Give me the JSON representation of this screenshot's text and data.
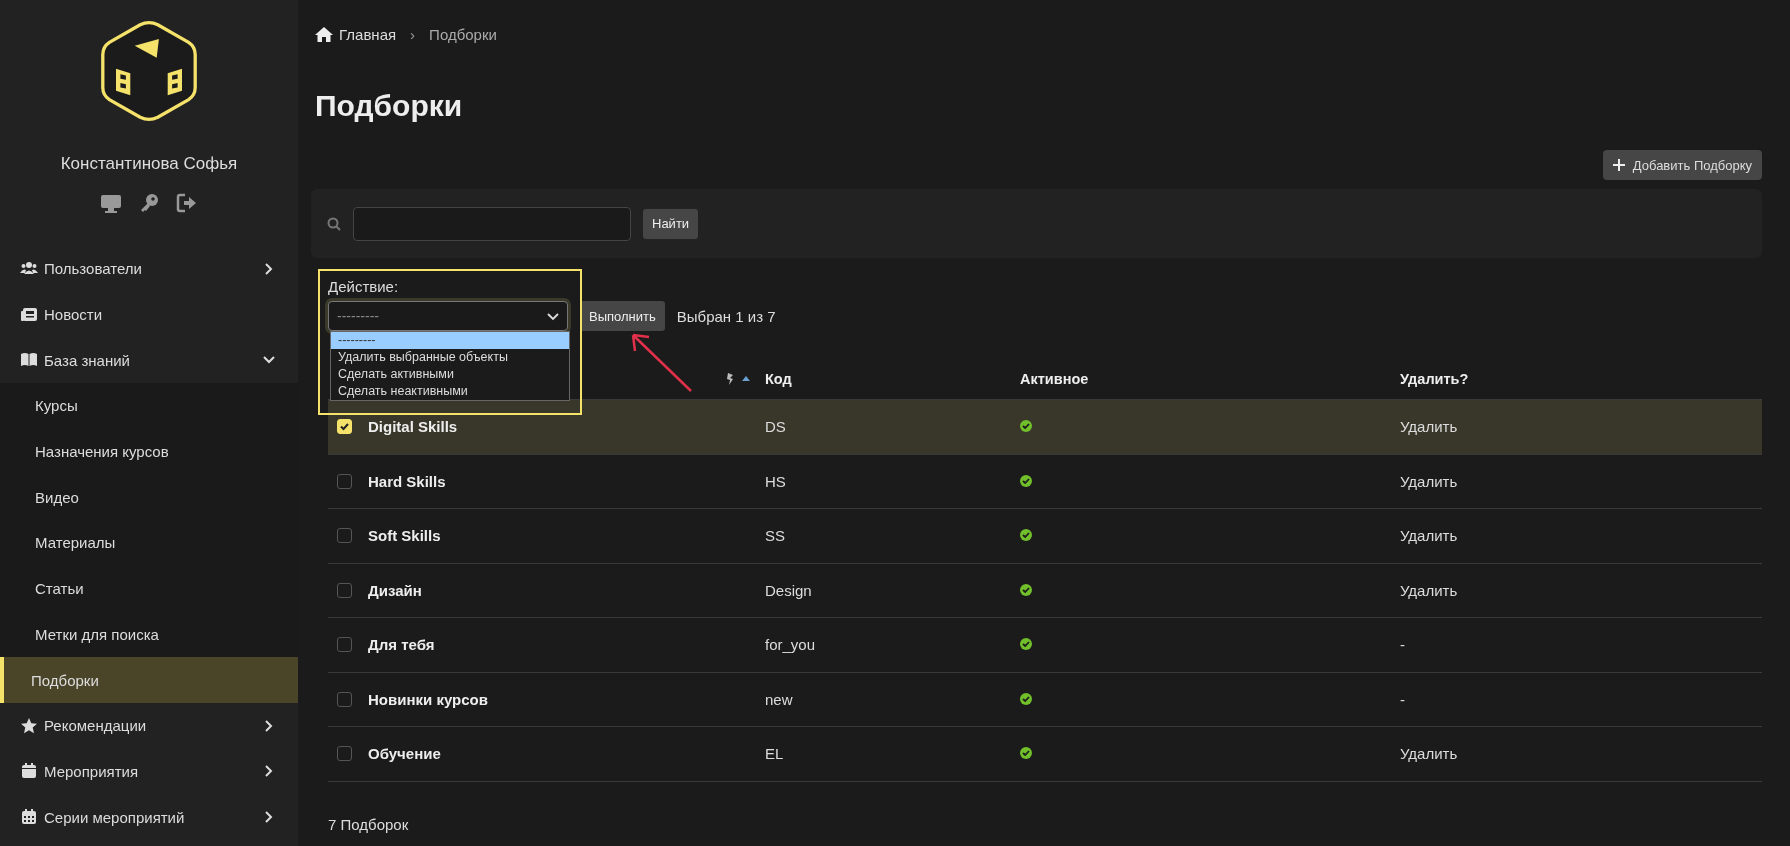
{
  "sidebar": {
    "user_name": "Константинова Софья",
    "menu": [
      {
        "label": "Пользователи",
        "kind": "group",
        "expanded": false,
        "selected": false
      },
      {
        "label": "Новости",
        "kind": "link",
        "selected": false
      },
      {
        "label": "База знаний",
        "kind": "group",
        "expanded": true,
        "selected": false,
        "children": [
          {
            "label": "Курсы",
            "selected": false
          },
          {
            "label": "Назначения курсов",
            "selected": false
          },
          {
            "label": "Видео",
            "selected": false
          },
          {
            "label": "Материалы",
            "selected": false
          },
          {
            "label": "Статьи",
            "selected": false
          },
          {
            "label": "Метки для поиска",
            "selected": false
          },
          {
            "label": "Подборки",
            "selected": true
          }
        ]
      },
      {
        "label": "Рекомендации",
        "kind": "group",
        "expanded": false,
        "selected": false
      },
      {
        "label": "Мероприятия",
        "kind": "group",
        "expanded": false,
        "selected": false
      },
      {
        "label": "Серии мероприятий",
        "kind": "group",
        "expanded": false,
        "selected": false
      }
    ]
  },
  "breadcrumb": [
    "Главная",
    "›",
    "Подборки"
  ],
  "title": "Подборки",
  "add_button": "Добавить Подборку",
  "search": {
    "button": "Найти"
  },
  "action": {
    "label": "Действие:",
    "value": "---------",
    "button": "Выполнить",
    "counter": "Выбран 1 из 7",
    "options": [
      {
        "label": "---------",
        "selected": true
      },
      {
        "label": "Удалить выбранные объекты",
        "selected": false
      },
      {
        "label": "Сделать активными",
        "selected": false
      },
      {
        "label": "Сделать неактивными",
        "selected": false
      }
    ]
  },
  "table": {
    "columns": [
      "Код",
      "Активное",
      "Удалить?"
    ],
    "rows": [
      {
        "name": "Digital Skills",
        "code": "DS",
        "active": true,
        "delete": "Удалить",
        "checked": true
      },
      {
        "name": "Hard Skills",
        "code": "HS",
        "active": true,
        "delete": "Удалить",
        "checked": false
      },
      {
        "name": "Soft Skills",
        "code": "SS",
        "active": true,
        "delete": "Удалить",
        "checked": false
      },
      {
        "name": "Дизайн",
        "code": "Design",
        "active": true,
        "delete": "Удалить",
        "checked": false
      },
      {
        "name": "Для тебя",
        "code": "for_you",
        "active": true,
        "delete": "-",
        "checked": false
      },
      {
        "name": "Новинки курсов",
        "code": "new",
        "active": true,
        "delete": "-",
        "checked": false
      },
      {
        "name": "Обучение",
        "code": "EL",
        "active": true,
        "delete": "Удалить",
        "checked": false
      }
    ]
  },
  "footer": "7 Подборок"
}
